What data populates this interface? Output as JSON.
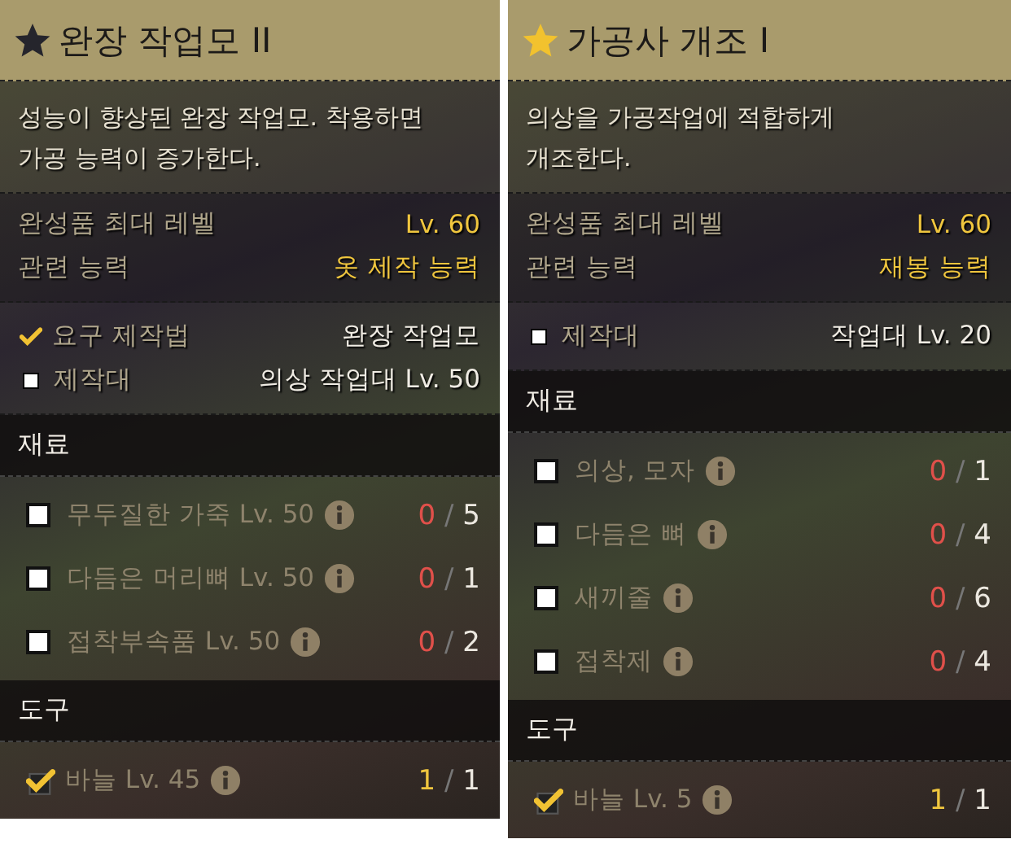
{
  "panels": [
    {
      "title": "완장 작업모 II",
      "star": {
        "color": "#25252c"
      },
      "description": [
        "성능이 향상된 완장 작업모. 착용하면",
        "가공 능력이 증가한다."
      ],
      "stats": [
        {
          "label": "완성품 최대 레벨",
          "value": "Lv. 60"
        },
        {
          "label": "관련 능력",
          "value": "옷 제작 능력"
        }
      ],
      "requirements": [
        {
          "label": "요구 제작법",
          "value": "완장 작업모",
          "checked": true
        },
        {
          "label": "제작대",
          "value": "의상 작업대 Lv. 50",
          "checked": false
        }
      ],
      "sections": [
        {
          "title": "재료",
          "items": [
            {
              "name": "무두질한 가죽 Lv. 50",
              "have": "0",
              "separator": "/",
              "need": "5",
              "checked": false
            },
            {
              "name": "다듬은 머리뼈 Lv. 50",
              "have": "0",
              "separator": "/",
              "need": "1",
              "checked": false
            },
            {
              "name": "접착부속품 Lv. 50",
              "have": "0",
              "separator": "/",
              "need": "2",
              "checked": false
            }
          ]
        },
        {
          "title": "도구",
          "items": [
            {
              "name": "바늘 Lv. 45",
              "have": "1",
              "separator": "/",
              "need": "1",
              "checked": true
            }
          ]
        }
      ]
    },
    {
      "title": "가공사 개조 I",
      "star": {
        "color": "#f2c22e"
      },
      "description": [
        "의상을 가공작업에 적합하게",
        "개조한다."
      ],
      "stats": [
        {
          "label": "완성품 최대 레벨",
          "value": "Lv. 60"
        },
        {
          "label": "관련 능력",
          "value": "재봉 능력"
        }
      ],
      "requirements": [
        {
          "label": "제작대",
          "value": "작업대 Lv. 20",
          "checked": false
        }
      ],
      "sections": [
        {
          "title": "재료",
          "items": [
            {
              "name": "의상, 모자",
              "have": "0",
              "separator": "/",
              "need": "1",
              "checked": false
            },
            {
              "name": "다듬은 뼈",
              "have": "0",
              "separator": "/",
              "need": "4",
              "checked": false
            },
            {
              "name": "새끼줄",
              "have": "0",
              "separator": "/",
              "need": "6",
              "checked": false
            },
            {
              "name": "접착제",
              "have": "0",
              "separator": "/",
              "need": "4",
              "checked": false
            }
          ]
        },
        {
          "title": "도구",
          "items": [
            {
              "name": "바늘 Lv. 5",
              "have": "1",
              "separator": "/",
              "need": "1",
              "checked": true
            }
          ]
        }
      ]
    }
  ]
}
